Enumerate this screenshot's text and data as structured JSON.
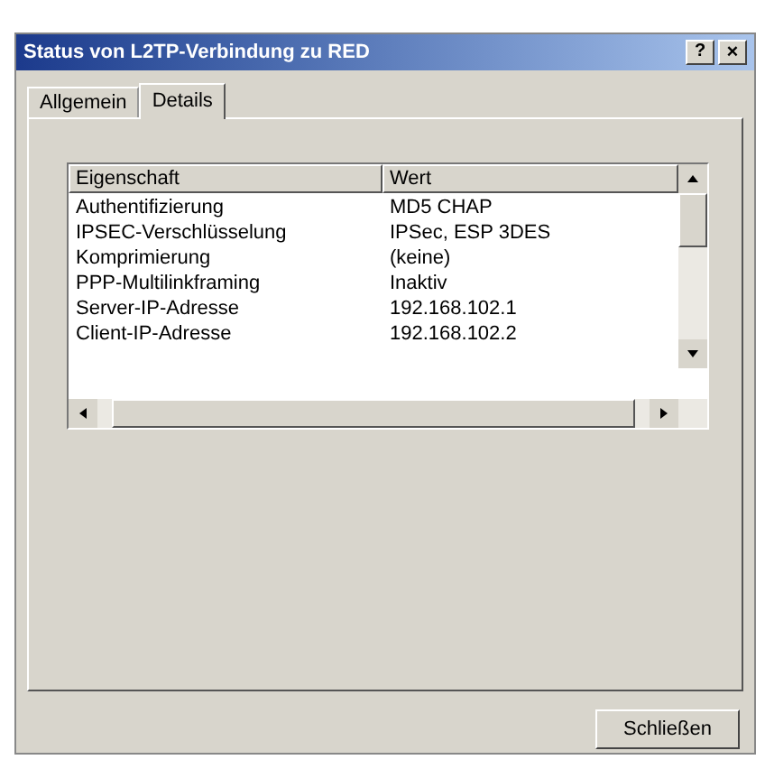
{
  "window": {
    "title": "Status von L2TP-Verbindung zu RED",
    "help_button": "?",
    "close_button": "×"
  },
  "tabs": [
    {
      "label": "Allgemein",
      "selected": false
    },
    {
      "label": "Details",
      "selected": true
    }
  ],
  "table": {
    "columns": [
      "Eigenschaft",
      "Wert"
    ],
    "rows": [
      [
        "Authentifizierung",
        "MD5 CHAP"
      ],
      [
        "IPSEC-Verschlüsselung",
        "IPSec, ESP 3DES"
      ],
      [
        "Komprimierung",
        "(keine)"
      ],
      [
        "PPP-Multilinkframing",
        "Inaktiv"
      ],
      [
        "Server-IP-Adresse",
        "192.168.102.1"
      ],
      [
        "Client-IP-Adresse",
        "192.168.102.2"
      ]
    ]
  },
  "buttons": [
    "Schließen"
  ]
}
